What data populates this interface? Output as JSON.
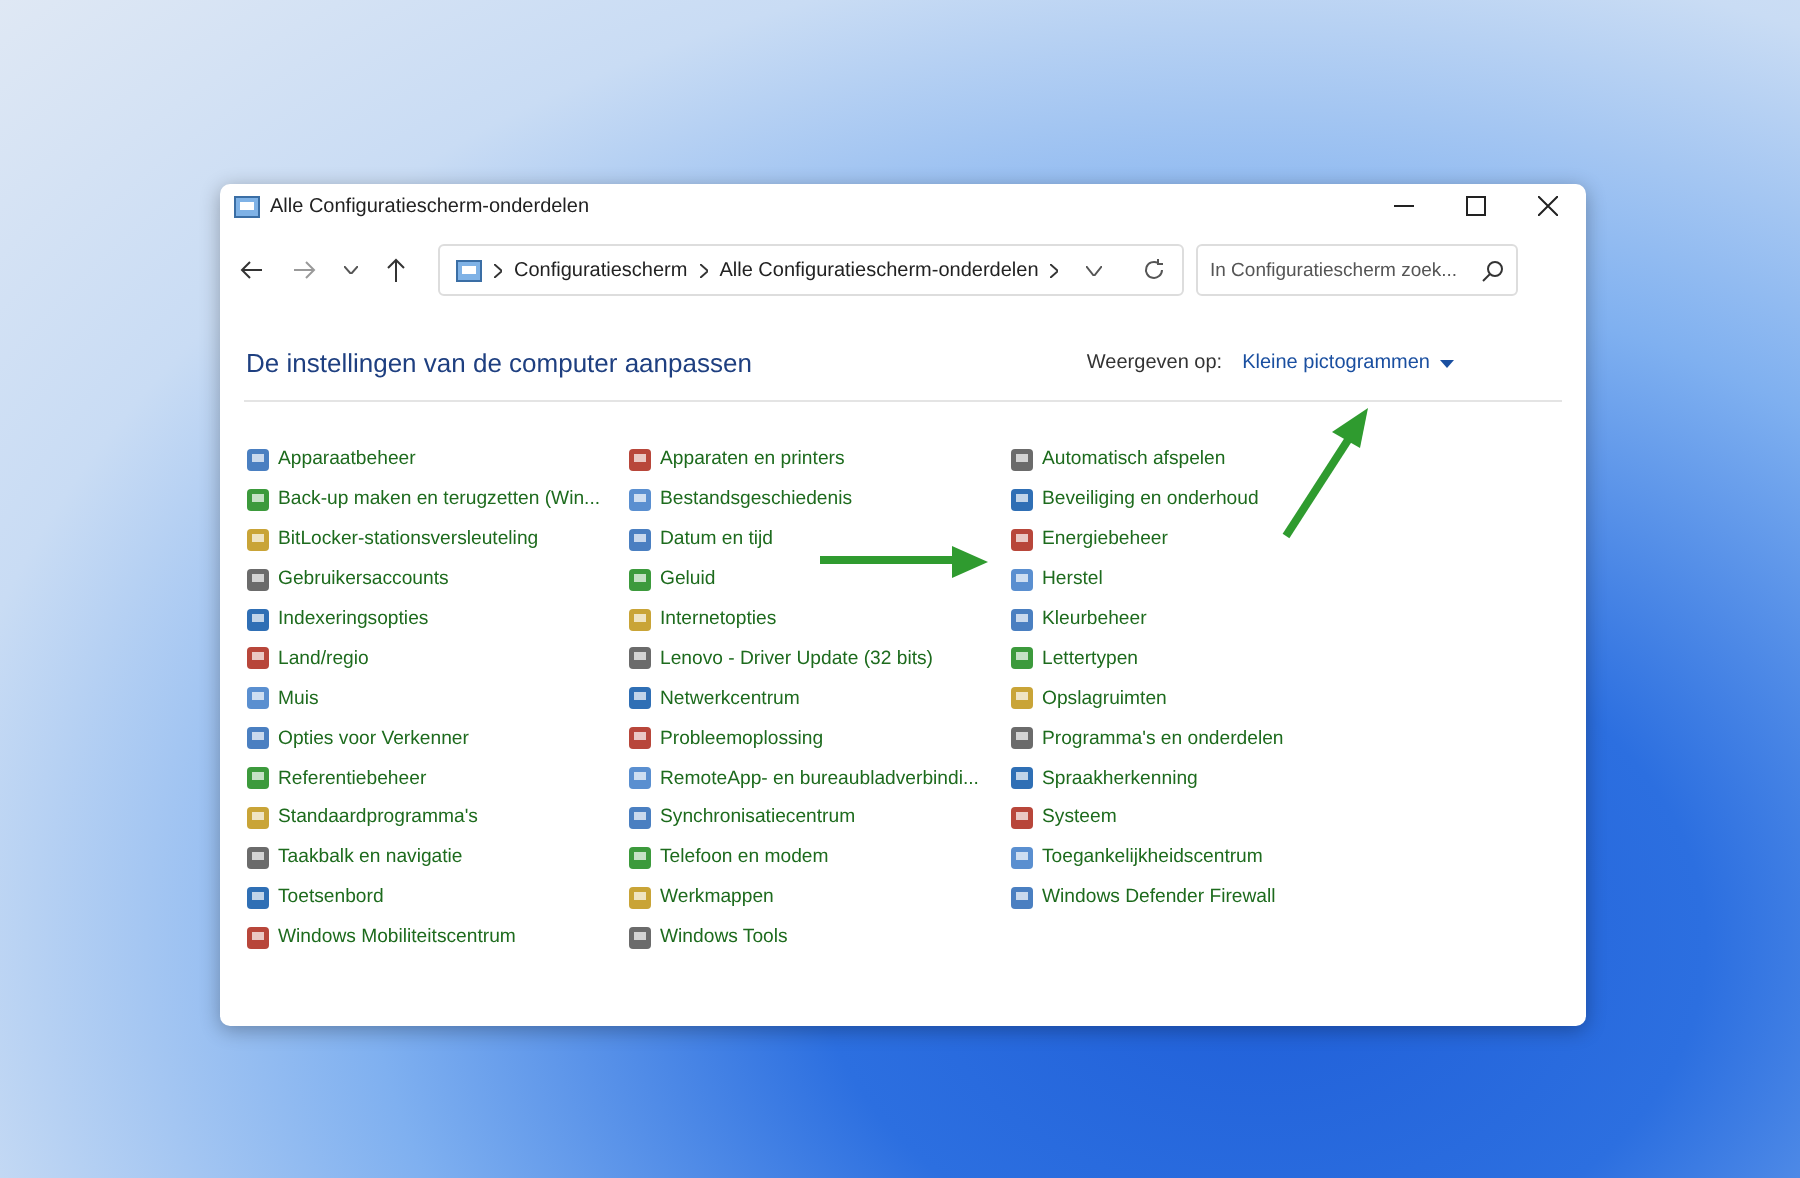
{
  "window": {
    "title": "Alle Configuratiescherm-onderdelen"
  },
  "address_bar": {
    "crumbs": [
      "Configuratiescherm",
      "Alle Configuratiescherm-onderdelen"
    ]
  },
  "search": {
    "placeholder": "In Configuratiescherm zoek..."
  },
  "header": {
    "title": "De instellingen van de computer aanpassen",
    "view_label": "Weergeven op:",
    "view_value": "Kleine pictogrammen"
  },
  "columns": [
    [
      "Apparaatbeheer",
      "Back-up maken en terugzetten (Win...",
      "BitLocker-stationsversleuteling",
      "Gebruikersaccounts",
      "Indexeringsopties",
      "Land/regio",
      "Muis",
      "Opties voor Verkenner",
      "Referentiebeheer",
      "Standaardprogramma's",
      "Taakbalk en navigatie",
      "Toetsenbord",
      "Windows Mobiliteitscentrum"
    ],
    [
      "Apparaten en printers",
      "Bestandsgeschiedenis",
      "Datum en tijd",
      "Geluid",
      "Internetopties",
      "Lenovo - Driver Update (32 bits)",
      "Netwerkcentrum",
      "Probleemoplossing",
      "RemoteApp- en bureaubladverbindi...",
      "Synchronisatiecentrum",
      "Telefoon en modem",
      "Werkmappen",
      "Windows Tools"
    ],
    [
      "Automatisch afspelen",
      "Beveiliging en onderhoud",
      "Energiebeheer",
      "Herstel",
      "Kleurbeheer",
      "Lettertypen",
      "Opslagruimten",
      "Programma's en onderdelen",
      "Spraakherkenning",
      "Systeem",
      "Toegankelijkheidscentrum",
      "Windows Defender Firewall"
    ]
  ]
}
